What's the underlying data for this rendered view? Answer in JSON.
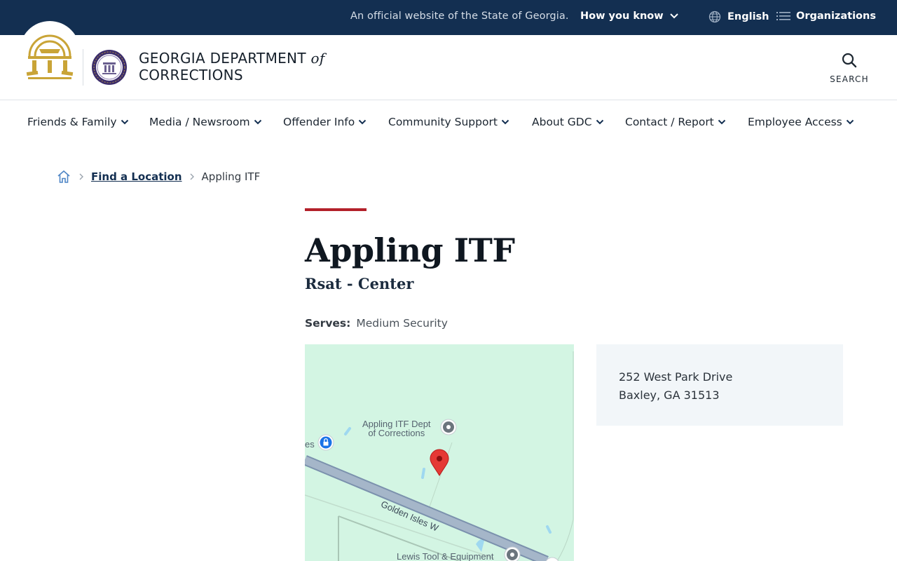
{
  "topbar": {
    "official": "An official website of the State of Georgia.",
    "how_you_know": "How you know",
    "language": "English",
    "organizations": "Organizations"
  },
  "header": {
    "brand_line1": "GEORGIA DEPARTMENT",
    "brand_of": "of",
    "brand_line2": "CORRECTIONS",
    "search_label": "SEARCH"
  },
  "nav": {
    "items": [
      {
        "label": "Friends & Family"
      },
      {
        "label": "Media / Newsroom"
      },
      {
        "label": "Offender Info"
      },
      {
        "label": "Community Support"
      },
      {
        "label": "About GDC"
      },
      {
        "label": "Contact / Report"
      },
      {
        "label": "Employee Access"
      }
    ]
  },
  "breadcrumb": {
    "link": "Find a Location",
    "current": "Appling ITF"
  },
  "page": {
    "title": "Appling ITF",
    "subtitle": "Rsat - Center",
    "serves_label": "Serves:",
    "serves_value": "Medium Security"
  },
  "map": {
    "poi_line1": "Appling ITF Dept",
    "poi_line2": "of Corrections",
    "left_poi_fragment": "es",
    "road": "Golden Isles W",
    "bottom_poi": "Lewis Tool & Equipment"
  },
  "address": {
    "line1": "252 West Park Drive",
    "line2": "Baxley, GA 31513"
  },
  "colors": {
    "navy": "#132f51",
    "accent_red": "#b3202a",
    "map_green": "#d3f5e3",
    "gold": "#c9a437"
  }
}
